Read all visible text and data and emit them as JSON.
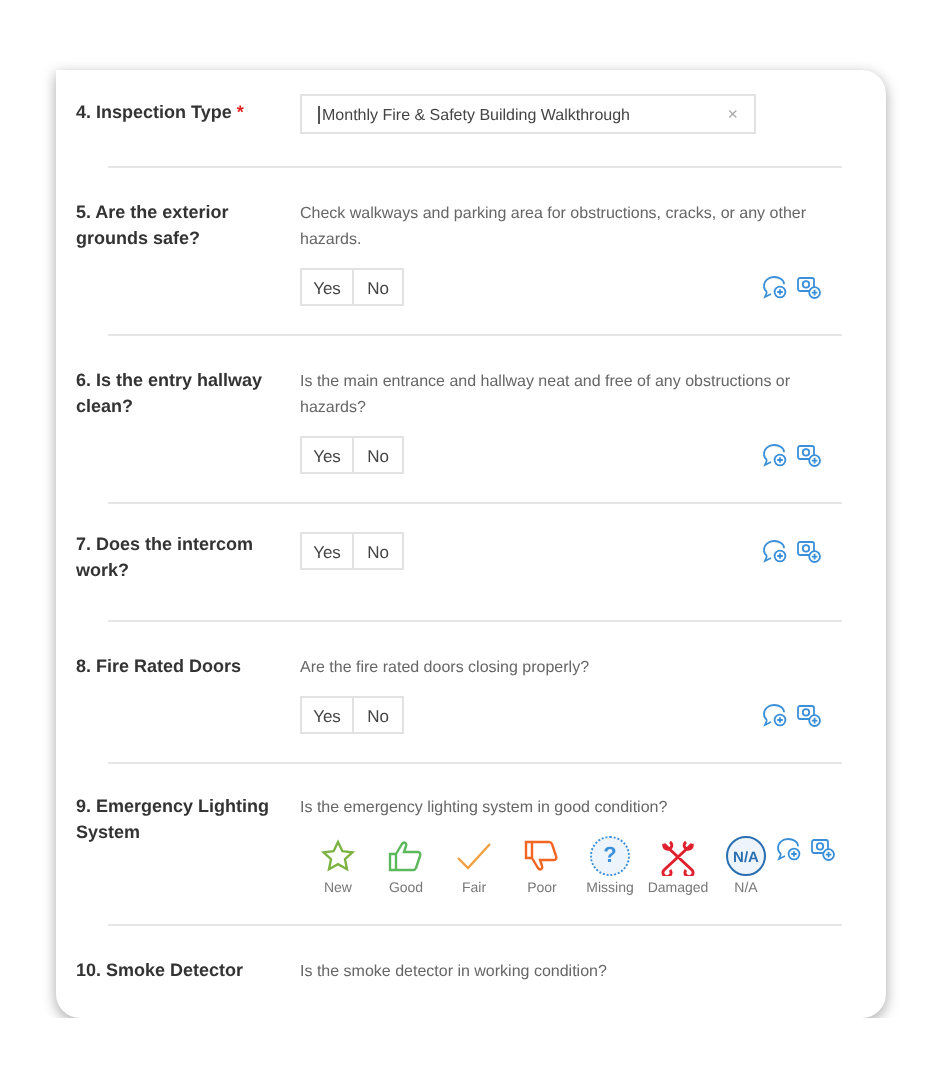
{
  "questions": [
    {
      "kind": "select",
      "label": "4. Inspection Type",
      "required": true,
      "required_mark": "*",
      "value": "Monthly Fire & Safety Building Walkthrough",
      "clear": "×"
    },
    {
      "kind": "yes_no",
      "label": "5. Are the exterior grounds safe?",
      "description": "Check walkways and parking area for obstructions, cracks, or any other hazards.",
      "options": [
        {
          "label": "Yes",
          "selected": false
        },
        {
          "label": "No",
          "selected": false
        }
      ]
    },
    {
      "kind": "yes_no",
      "label": "6. Is the entry hallway clean?",
      "description": "Is the main entrance and hallway neat and free of any obstructions or hazards?",
      "options": [
        {
          "label": "Yes",
          "selected": false
        },
        {
          "label": "No",
          "selected": false
        }
      ]
    },
    {
      "kind": "yes_no",
      "label": "7. Does the intercom work?",
      "options": [
        {
          "label": "Yes",
          "selected": false
        },
        {
          "label": "No",
          "selected": false
        }
      ]
    },
    {
      "kind": "yes_no",
      "label": "8. Fire Rated Doors",
      "description": "Are the fire rated doors closing properly?",
      "options": [
        {
          "label": "Yes",
          "selected": false
        },
        {
          "label": "No",
          "selected": false
        }
      ]
    },
    {
      "kind": "condition",
      "label": "9. Emergency Lighting System",
      "description": "Is the emergency lighting system in good condition?",
      "ratings": [
        {
          "kind": "star",
          "label": "New",
          "color": "#7cb342",
          "selected": false
        },
        {
          "kind": "thumb_up",
          "label": "Good",
          "color": "#5cb85c",
          "selected": false
        },
        {
          "kind": "check",
          "label": "Fair",
          "color": "#f0a040",
          "selected": false
        },
        {
          "kind": "thumb_down",
          "label": "Poor",
          "color": "#f26522",
          "selected": false
        },
        {
          "kind": "question",
          "label": "Missing",
          "color": "#3a8fd9",
          "symbol": "?",
          "selected": false
        },
        {
          "kind": "wrench",
          "label": "Damaged",
          "color": "#e0202e",
          "selected": false
        },
        {
          "kind": "na",
          "label": "N/A",
          "color": "#2a6fb0",
          "symbol": "N/A",
          "selected": false
        }
      ]
    },
    {
      "kind": "text_only",
      "label": "10. Smoke Detector",
      "description": "Is the smoke detector in working condition?"
    }
  ]
}
